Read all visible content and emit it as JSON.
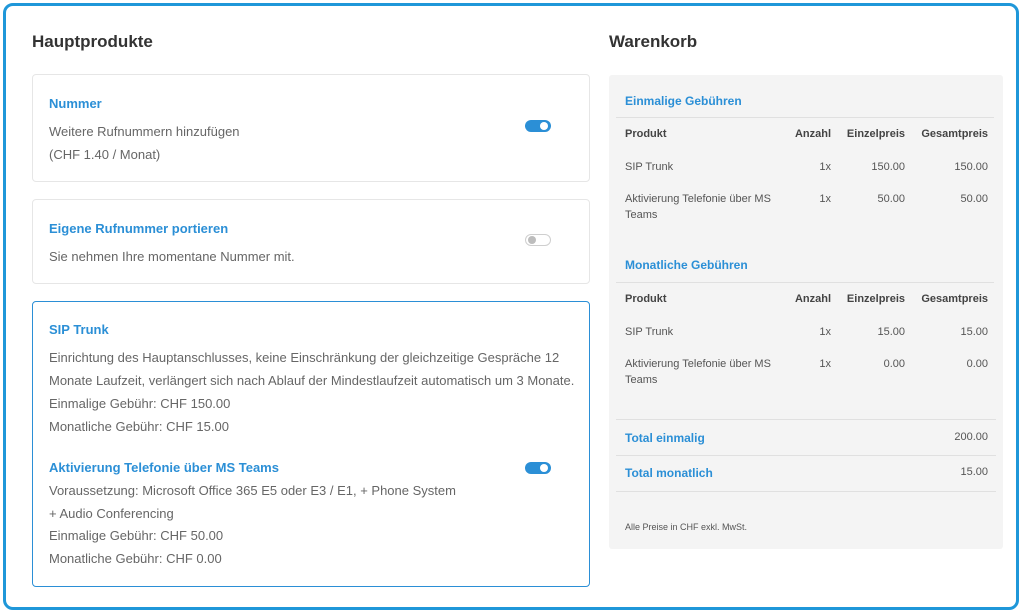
{
  "main": {
    "title": "Hauptprodukte",
    "cards": [
      {
        "title": "Nummer",
        "lines": [
          "Weitere Rufnummern hinzufügen",
          "(CHF 1.40 / Monat)"
        ],
        "toggle": "on"
      },
      {
        "title": "Eigene Rufnummer portieren",
        "lines": [
          "Sie nehmen Ihre momentane Nummer mit."
        ],
        "toggle": "off"
      },
      {
        "title": "SIP Trunk",
        "lines": [
          "Einrichtung des Hauptanschlusses, keine Einschränkung der gleichzeitige Gespräche 12",
          "Monate Laufzeit, verlängert sich nach Ablauf der Mindestlaufzeit automatisch um 3 Monate.",
          "Einmalige Gebühr: CHF 150.00",
          "Monatliche Gebühr: CHF 15.00"
        ],
        "option": {
          "title": "Aktivierung Telefonie über MS Teams",
          "lines": [
            "Voraussetzung: Microsoft Office 365 E5 oder E3 / E1, + Phone System",
            "+ Audio Conferencing",
            "Einmalige Gebühr: CHF 50.00",
            "Monatliche Gebühr: CHF 0.00"
          ],
          "toggle": "on"
        }
      }
    ]
  },
  "cart": {
    "title": "Warenkorb",
    "headers": {
      "product": "Produkt",
      "qty": "Anzahl",
      "unit": "Einzelpreis",
      "total": "Gesamtpreis"
    },
    "onetime": {
      "title": "Einmalige Gebühren",
      "rows": [
        {
          "product": "SIP Trunk",
          "qty": "1x",
          "unit": "150.00",
          "total": "150.00"
        },
        {
          "product": "Aktivierung Telefonie über MS Teams",
          "qty": "1x",
          "unit": "50.00",
          "total": "50.00"
        }
      ]
    },
    "monthly": {
      "title": "Monatliche Gebühren",
      "rows": [
        {
          "product": "SIP Trunk",
          "qty": "1x",
          "unit": "15.00",
          "total": "15.00"
        },
        {
          "product": "Aktivierung Telefonie über MS Teams",
          "qty": "1x",
          "unit": "0.00",
          "total": "0.00"
        }
      ]
    },
    "totals": {
      "onetime_label": "Total einmalig",
      "onetime_value": "200.00",
      "monthly_label": "Total monatlich",
      "monthly_value": "15.00"
    },
    "note": "Alle Preise in CHF exkl. MwSt."
  }
}
